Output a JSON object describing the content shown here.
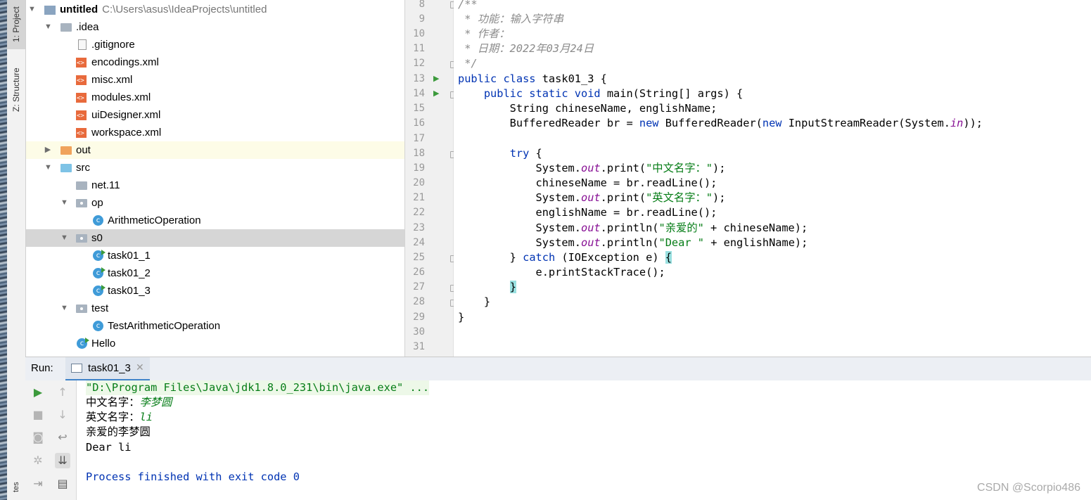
{
  "toolwindow_tabs": {
    "project": "1: Project",
    "structure": "Z: Structure",
    "bottom": "tes"
  },
  "project": {
    "root_name": "untitled",
    "root_path": "C:\\Users\\asus\\IdeaProjects\\untitled",
    "idea_folder": ".idea",
    "idea_files": [
      ".gitignore",
      "encodings.xml",
      "misc.xml",
      "modules.xml",
      "uiDesigner.xml",
      "workspace.xml"
    ],
    "out_folder": "out",
    "src_folder": "src",
    "net_folder": "net.11",
    "op_folder": "op",
    "op_class": "ArithmeticOperation",
    "s0_folder": "s0",
    "s0_classes": [
      "task01_1",
      "task01_2",
      "task01_3"
    ],
    "test_folder": "test",
    "test_class": "TestArithmeticOperation",
    "hello_class": "Hello"
  },
  "editor": {
    "line_numbers": [
      "8",
      "9",
      "10",
      "11",
      "12",
      "13",
      "14",
      "15",
      "16",
      "17",
      "18",
      "19",
      "20",
      "21",
      "22",
      "23",
      "24",
      "25",
      "26",
      "27",
      "28",
      "29",
      "30",
      "31"
    ],
    "code": {
      "l8": "/**",
      "l9": " * 功能：输入字符串",
      "l10": " * 作者：",
      "l11": " * 日期：2022年03月24日",
      "l12": " */",
      "l13a": "public class",
      "l13b": " task01_3 {",
      "l14a": "    public static void",
      "l14b": " main(String[] args) {",
      "l15": "        String chineseName, englishName;",
      "l16a": "        BufferedReader br = ",
      "l16b": "new",
      "l16c": " BufferedReader(",
      "l16d": "new",
      "l16e": " InputStreamReader(System.",
      "l16f": "in",
      "l16g": "));",
      "l18a": "        ",
      "l18b": "try",
      "l18c": " {",
      "l19a": "            System.",
      "l19b": "out",
      "l19c": ".print(",
      "l19d": "\"中文名字：\"",
      "l19e": ");",
      "l20": "            chineseName = br.readLine();",
      "l21a": "            System.",
      "l21b": "out",
      "l21c": ".print(",
      "l21d": "\"英文名字：\"",
      "l21e": ");",
      "l22": "            englishName = br.readLine();",
      "l23a": "            System.",
      "l23b": "out",
      "l23c": ".println(",
      "l23d": "\"亲爱的\"",
      "l23e": " + chineseName);",
      "l24a": "            System.",
      "l24b": "out",
      "l24c": ".println(",
      "l24d": "\"Dear \"",
      "l24e": " + englishName);",
      "l25a": "        } ",
      "l25b": "catch",
      "l25c": " (IOException e) ",
      "l25d": "{",
      "l26": "            e.printStackTrace();",
      "l27a": "        ",
      "l27b": "}",
      "l28": "    }",
      "l29": "}"
    }
  },
  "run": {
    "title": "Run:",
    "tab_label": "task01_3",
    "cmd": "\"D:\\Program Files\\Java\\jdk1.8.0_231\\bin\\java.exe\" ...",
    "out1_prompt": "中文名字：",
    "out1_input": "李梦圆",
    "out2_prompt": "英文名字：",
    "out2_input": "li",
    "out3": "亲爱的李梦圆",
    "out4": "Dear li",
    "exit": "Process finished with exit code 0"
  },
  "watermark": "CSDN @Scorpio486"
}
